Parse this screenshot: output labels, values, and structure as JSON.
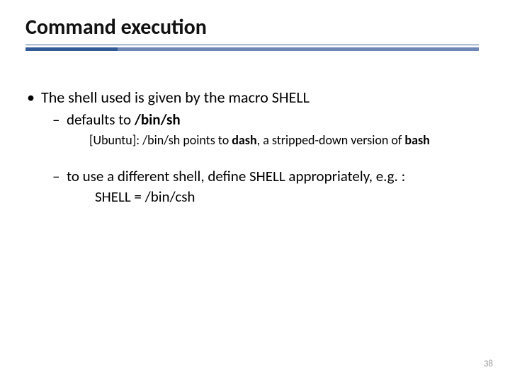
{
  "title": "Command execution",
  "bullets": {
    "b1": "The shell used is given by the macro SHELL",
    "b2a_pre": "defaults to ",
    "b2a_bold": "/bin/sh",
    "note_pre": "[Ubuntu]: /bin/sh points to ",
    "note_bold1": "dash",
    "note_mid": ", a stripped-down version of ",
    "note_bold2": "bash",
    "b2b": "to  use a different shell, define SHELL appropriately, e.g. :",
    "shell_line": "SHELL =  /bin/csh"
  },
  "page_number": "38"
}
